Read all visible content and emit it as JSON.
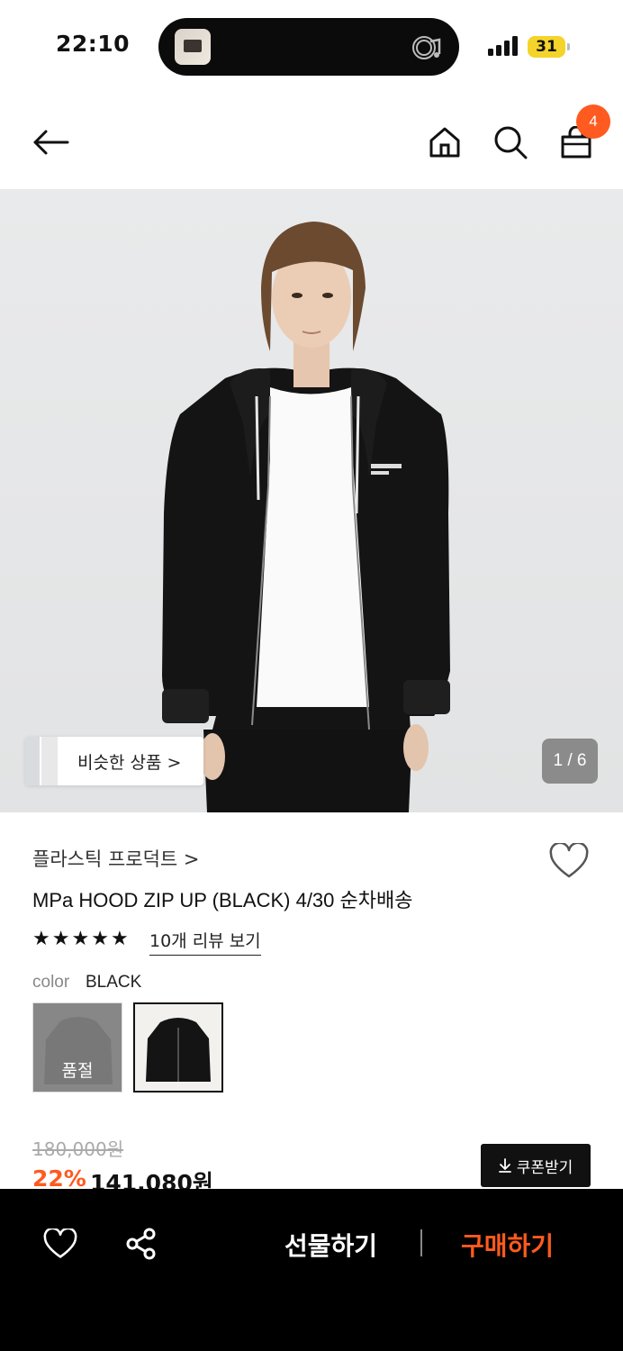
{
  "status_bar": {
    "time": "22:10",
    "battery": "31"
  },
  "nav": {
    "cart_count": "4"
  },
  "gallery": {
    "similar_label": "비슷한 상품 >",
    "page_indicator": "1 / 6"
  },
  "product": {
    "brand": "플라스틱 프로덕트 >",
    "title": "MPa HOOD ZIP UP (BLACK) 4/30 순차배송",
    "rating": 5,
    "review_link": "10개 리뷰 보기",
    "color_label": "color",
    "color_value": "BLACK",
    "swatches": [
      {
        "status": "품절"
      },
      {
        "status": ""
      }
    ],
    "original_price": "180,000원",
    "discount": "22%",
    "sale_price": "141,080원",
    "coupon_label": "쿠폰받기"
  },
  "bottom_bar": {
    "gift_label": "선물하기",
    "buy_label": "구매하기"
  },
  "colors": {
    "accent": "#ff5a1f",
    "dark": "#000000"
  }
}
